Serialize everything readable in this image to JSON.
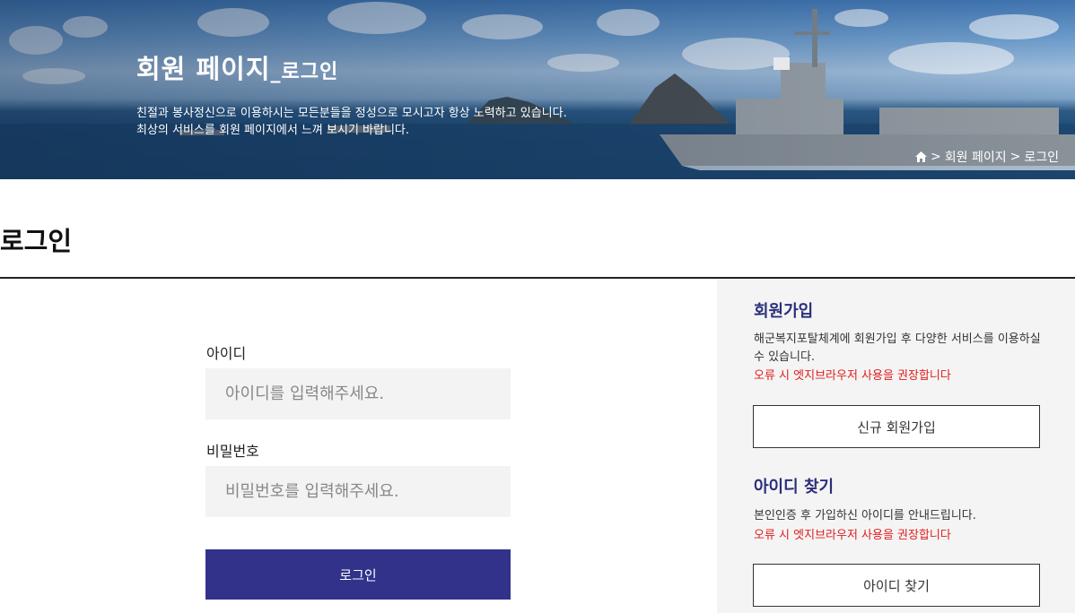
{
  "hero": {
    "title_main": "회원 페이지",
    "title_sub": "_로그인",
    "desc_line1": "친절과 봉사정신으로 이용하시는 모든분들을 정성으로 모시고자 항상 노력하고 있습니다.",
    "desc_line2": "최상의 서비스를 회원 페이지에서 느껴 보시기 바랍니다."
  },
  "breadcrumb": {
    "items": [
      "회원 페이지",
      "로그인"
    ],
    "separator": ">"
  },
  "page": {
    "title": "로그인"
  },
  "login": {
    "id_label": "아이디",
    "id_placeholder": "아이디를 입력해주세요.",
    "pw_label": "비밀번호",
    "pw_placeholder": "비밀번호를 입력해주세요.",
    "submit_label": "로그인"
  },
  "side": {
    "signup": {
      "heading": "회원가입",
      "desc": "해군복지포탈체계에 회원가입 후 다양한 서비스를 이용하실 수 있습니다.",
      "warning": "오류 시 엣지브라우저 사용을 권장합니다",
      "button": "신규 회원가입"
    },
    "find_id": {
      "heading": "아이디 찾기",
      "desc": "본인인증 후 가입하신 아이디를 안내드립니다.",
      "warning": "오류 시 엣지브라우저 사용을 권장합니다",
      "button": "아이디 찾기"
    }
  },
  "icons": {
    "home": "home-icon",
    "chevron": "chevron-right-icon"
  },
  "colors": {
    "primary": "#32328b",
    "heading": "#2b2f7a",
    "warning": "#e21c1c",
    "panel": "#f4f4f4"
  }
}
